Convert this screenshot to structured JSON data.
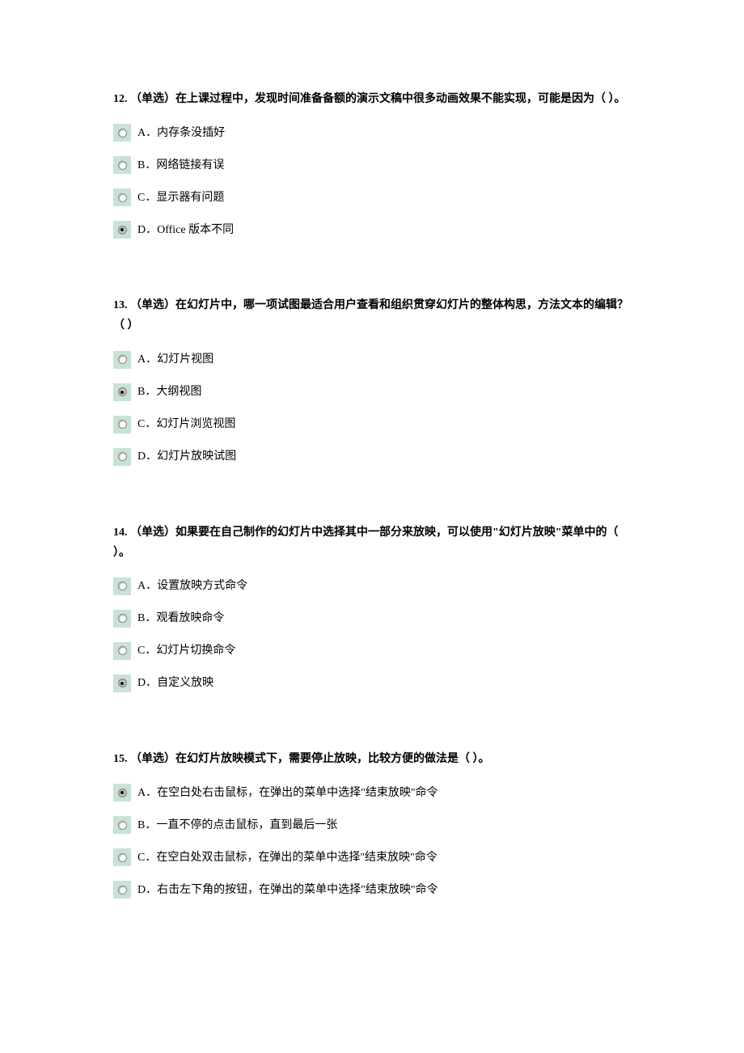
{
  "questions": [
    {
      "number": "12.",
      "type": "（单选）",
      "text": "在上课过程中，发现时间准备备额的演示文稿中很多动画效果不能实现，可能是因为（ ）。",
      "options": [
        {
          "label": "A．内存条没插好",
          "selected": false
        },
        {
          "label": "B．网络链接有误",
          "selected": false
        },
        {
          "label": "C．显示器有问题",
          "selected": false
        },
        {
          "label": "D．Office 版本不同",
          "selected": true
        }
      ]
    },
    {
      "number": "13.",
      "type": "（单选）",
      "text": "在幻灯片中，哪一项试图最适合用户查看和组织贯穿幻灯片的整体构思，方法文本的编辑？（ ）",
      "options": [
        {
          "label": "A．幻灯片视图",
          "selected": false
        },
        {
          "label": "B．大纲视图",
          "selected": true
        },
        {
          "label": "C．幻灯片浏览视图",
          "selected": false
        },
        {
          "label": "D．幻灯片放映试图",
          "selected": false
        }
      ]
    },
    {
      "number": "14.",
      "type": "（单选）",
      "text": "如果要在自己制作的幻灯片中选择其中一部分来放映，可以使用\"幻灯片放映\"菜单中的（ ）。",
      "options": [
        {
          "label": "A．设置放映方式命令",
          "selected": false
        },
        {
          "label": "B．观看放映命令",
          "selected": false
        },
        {
          "label": "C．幻灯片切换命令",
          "selected": false
        },
        {
          "label": "D．自定义放映",
          "selected": true
        }
      ]
    },
    {
      "number": "15.",
      "type": "（单选）",
      "text": "在幻灯片放映模式下，需要停止放映，比较方便的做法是（ ）。",
      "options": [
        {
          "label": "A．在空白处右击鼠标，在弹出的菜单中选择\"结束放映\"命令",
          "selected": true
        },
        {
          "label": "B．一直不停的点击鼠标，直到最后一张",
          "selected": false
        },
        {
          "label": "C．在空白处双击鼠标，在弹出的菜单中选择\"结束放映\"命令",
          "selected": false
        },
        {
          "label": "D．右击左下角的按钮，在弹出的菜单中选择\"结束放映\"命令",
          "selected": false
        }
      ]
    }
  ]
}
